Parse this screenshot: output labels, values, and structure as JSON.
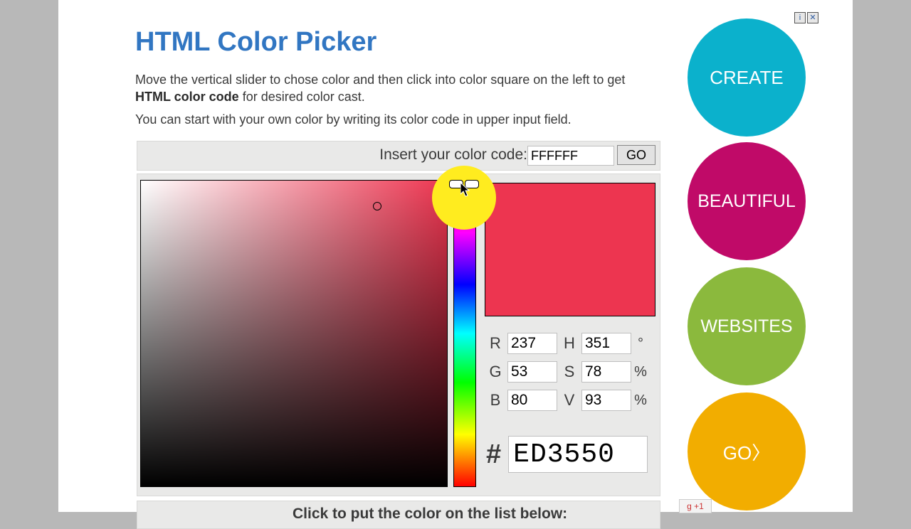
{
  "title": "HTML Color Picker",
  "intro_a": "Move the vertical slider to chose color and then click into color square on the left to get ",
  "intro_b": "HTML color code",
  "intro_c": " for desired color cast.",
  "intro2": "You can start with your own color by writing its color code in upper input field.",
  "toolbar": {
    "label": "Insert your color code:",
    "value": "FFFFFF",
    "go": "GO"
  },
  "preview_color": "#ED3550",
  "rgb": {
    "r_label": "R",
    "r": "237",
    "g_label": "G",
    "g": "53",
    "b_label": "B",
    "b": "80"
  },
  "hsv": {
    "h_label": "H",
    "h": "351",
    "h_unit": "°",
    "s_label": "S",
    "s": "78",
    "s_unit": "%",
    "v_label": "V",
    "v": "93",
    "v_unit": "%"
  },
  "hex_hash": "#",
  "hex": "ED3550",
  "footer": "Click to put the color on the list below:",
  "ad": {
    "info_glyph": "i",
    "close_glyph": "✕",
    "b1": "CREATE",
    "b2": "BEAUTIFUL",
    "b3": "WEBSITES",
    "b4": "GO〉"
  },
  "gplus": "g +1"
}
